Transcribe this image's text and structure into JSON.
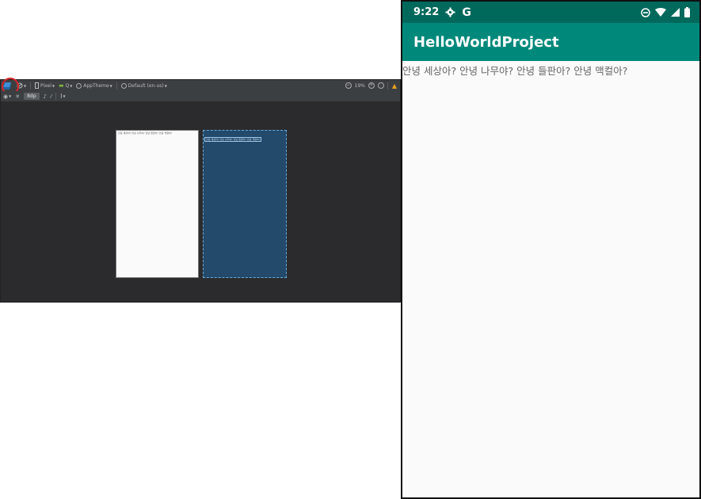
{
  "studio": {
    "toolbar": {
      "device": "Pixel",
      "api": "Q",
      "theme": "AppTheme",
      "locale": "Default (en-us)",
      "zoom": "19%",
      "margin": "8dp"
    },
    "preview_text": "안녕 세상아? 안녕 나무야? 안녕 들판아? 안녕 맥컬아?"
  },
  "phone": {
    "time": "9:22",
    "status_letter": "G",
    "app_title": "HelloWorldProject",
    "text": "안녕 세상아? 안녕 나무야? 안녕 들판아? 안녕 맥컬아?",
    "colors": {
      "statusbar": "#00695c",
      "appbar": "#00897b",
      "highlight": "#d6262b"
    }
  }
}
